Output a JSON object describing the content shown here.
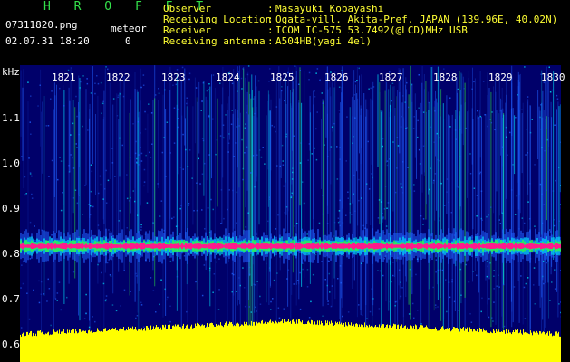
{
  "header": {
    "app_title": "H R O F F T",
    "filename": "07311820.png",
    "datetime": "02.07.31 18:20",
    "meteor_label": "meteor",
    "meteor_count": "0",
    "info": [
      {
        "key": "Observer",
        "value": "Masayuki Kobayashi"
      },
      {
        "key": "Receiving Location",
        "value": "Ogata-vill. Akita-Pref. JAPAN (139.96E, 40.02N)"
      },
      {
        "key": "Receiver",
        "value": "ICOM IC-575 53.7492(@LCD)MHz USB"
      },
      {
        "key": "Receiving antenna",
        "value": "A504HB(yagi 4el)"
      }
    ]
  },
  "spectrogram": {
    "unit_label": "kHz",
    "y_ticks": [
      "1.1",
      "1.0",
      "0.9",
      "0.8",
      "0.7",
      "0.6"
    ],
    "x_ticks": [
      "1821",
      "1822",
      "1823",
      "1824",
      "1825",
      "1826",
      "1827",
      "1828",
      "1829",
      "1830"
    ],
    "carrier_khz": 0.81,
    "colors": {
      "background": "#00006a",
      "noise_blue": "#2060ff",
      "cyan": "#00e8ff",
      "green": "#30ff40",
      "carrier": "#ff1a8c",
      "baseline": "#ffff00"
    }
  }
}
